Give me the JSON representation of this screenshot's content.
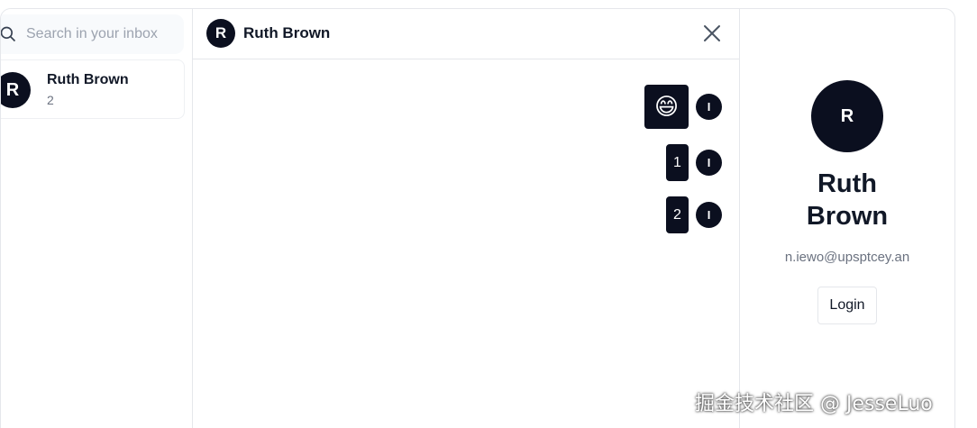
{
  "sidebar": {
    "search_placeholder": "Search in your inbox",
    "conversations": [
      {
        "avatar_initial": "R",
        "name": "Ruth Brown",
        "preview": "2"
      }
    ]
  },
  "chat": {
    "header": {
      "avatar_initial": "R",
      "title": "Ruth Brown"
    },
    "messages": [
      {
        "content": "😄",
        "sender_initial": "I"
      },
      {
        "content": "1",
        "sender_initial": "I"
      },
      {
        "content": "2",
        "sender_initial": "I"
      }
    ]
  },
  "profile": {
    "avatar_initial": "R",
    "name": "Ruth Brown",
    "email": "n.iewo@upsptcey.an",
    "login_label": "Login"
  },
  "watermark": "掘金技术社区 @ JesseLuo",
  "colors": {
    "dark": "#0b0f1f",
    "border": "#e5e7eb",
    "muted": "#6b7280"
  }
}
